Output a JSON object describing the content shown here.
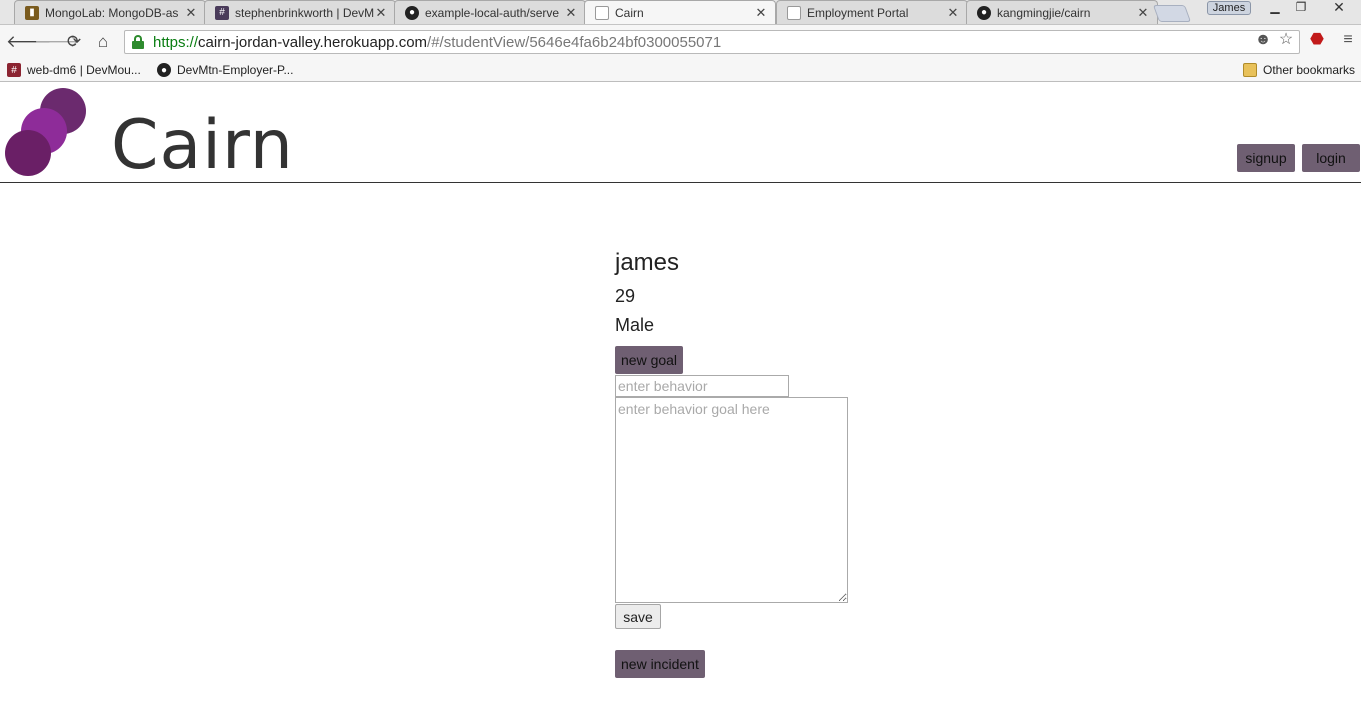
{
  "browser": {
    "tabs": [
      {
        "title": "MongoLab: MongoDB-as",
        "favicon": "mongolab-icon",
        "active": false
      },
      {
        "title": "stephenbrinkworth | DevM",
        "favicon": "slack-icon",
        "active": false
      },
      {
        "title": "example-local-auth/serve",
        "favicon": "github-icon",
        "active": false
      },
      {
        "title": "Cairn",
        "favicon": "page-icon",
        "active": true
      },
      {
        "title": "Employment Portal",
        "favicon": "page-icon",
        "active": false
      },
      {
        "title": "kangmingjie/cairn",
        "favicon": "github-icon",
        "active": false
      }
    ],
    "profile_name": "James",
    "url": {
      "scheme": "https://",
      "host": "cairn-jordan-valley.herokuapp.com",
      "path": "/#/studentView/5646e4fa6b24bf0300055071"
    },
    "bookmarks": [
      {
        "label": "web-dm6 | DevMou...",
        "icon": "slack-icon"
      },
      {
        "label": "DevMtn-Employer-P...",
        "icon": "github-icon"
      }
    ],
    "other_bookmarks_label": "Other bookmarks"
  },
  "header": {
    "brand": "Cairn",
    "signup_label": "signup",
    "login_label": "login",
    "accent_color": "#6f5f72",
    "logo_colors": [
      "#6b2a6e",
      "#8e2c99",
      "#6a1f66"
    ]
  },
  "student": {
    "name": "james",
    "age": "29",
    "gender": "Male"
  },
  "goal_form": {
    "new_goal_label": "new goal",
    "behavior_placeholder": "enter behavior",
    "goal_placeholder": "enter behavior goal here",
    "save_label": "save"
  },
  "incident": {
    "new_incident_label": "new incident"
  }
}
